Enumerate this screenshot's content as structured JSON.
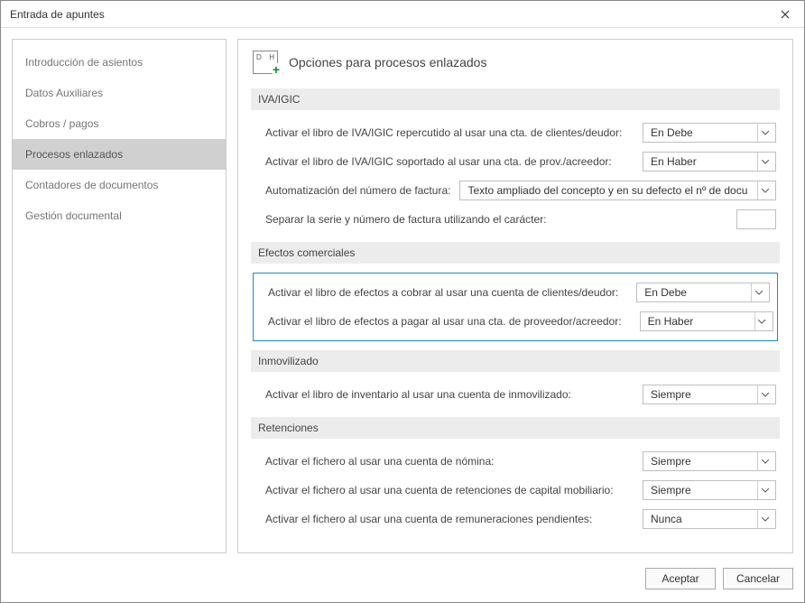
{
  "window": {
    "title": "Entrada de apuntes"
  },
  "sidebar": {
    "items": [
      {
        "label": "Introducción de asientos"
      },
      {
        "label": "Datos Auxiliares"
      },
      {
        "label": "Cobros / pagos"
      },
      {
        "label": "Procesos enlazados"
      },
      {
        "label": "Contadores de documentos"
      },
      {
        "label": "Gestión documental"
      }
    ],
    "selected_index": 3
  },
  "page": {
    "title": "Opciones para procesos enlazados",
    "icon": {
      "d": "D",
      "h": "H"
    }
  },
  "sections": {
    "iva": {
      "title": "IVA/IGIC",
      "rows": {
        "repercutido": {
          "label": "Activar el libro de IVA/IGIC repercutido al usar una cta. de clientes/deudor:",
          "value": "En Debe"
        },
        "soportado": {
          "label": "Activar el libro de IVA/IGIC soportado al usar una cta. de prov./acreedor:",
          "value": "En Haber"
        },
        "autonum": {
          "label": "Automatización del número de factura:",
          "value": "Texto ampliado del concepto y en su defecto el nº de docu"
        },
        "separador": {
          "label": "Separar la serie y número de factura utilizando el carácter:",
          "value": ""
        }
      }
    },
    "efectos": {
      "title": "Efectos comerciales",
      "rows": {
        "cobrar": {
          "label": "Activar el libro de efectos a cobrar al usar una cuenta de clientes/deudor:",
          "value": "En Debe"
        },
        "pagar": {
          "label": "Activar el libro de efectos a pagar al usar una cta. de proveedor/acreedor:",
          "value": "En Haber"
        }
      }
    },
    "inmovilizado": {
      "title": "Inmovilizado",
      "rows": {
        "inventario": {
          "label": "Activar el libro de inventario al usar una cuenta de inmovilizado:",
          "value": "Siempre"
        }
      }
    },
    "retenciones": {
      "title": "Retenciones",
      "rows": {
        "nomina": {
          "label": "Activar el fichero al usar una cuenta de nómina:",
          "value": "Siempre"
        },
        "capital": {
          "label": "Activar el fichero al usar una cuenta de retenciones de capital mobiliario:",
          "value": "Siempre"
        },
        "remun": {
          "label": "Activar el fichero al usar una cuenta de remuneraciones pendientes:",
          "value": "Nunca"
        }
      }
    }
  },
  "footer": {
    "ok": "Aceptar",
    "cancel": "Cancelar"
  }
}
